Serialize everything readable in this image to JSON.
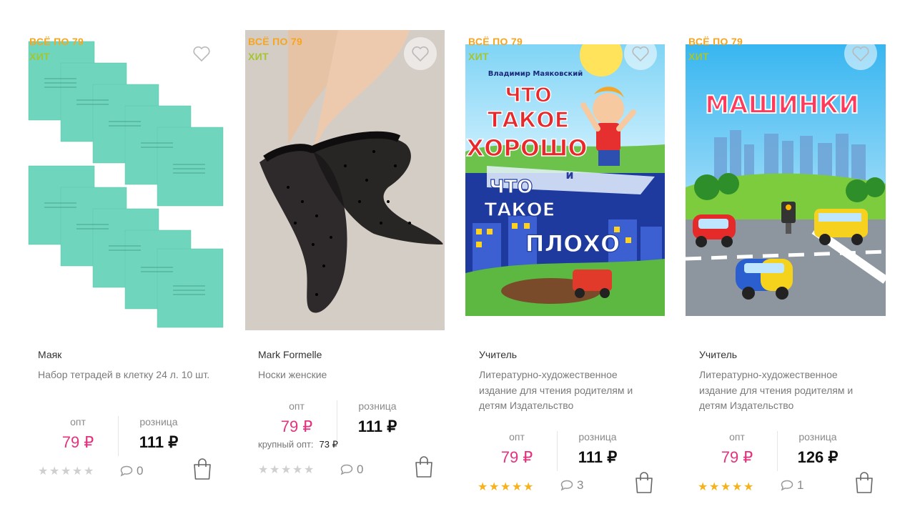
{
  "products": [
    {
      "badges": {
        "sale": "ВСЁ ПО 79",
        "hit": "ХИТ"
      },
      "image_icon": "notebooks-image",
      "brand": "Маяк",
      "description": "Набор тетрадей в клетку 24 л. 10 шт.",
      "labels": {
        "opt": "опт",
        "retail": "розница"
      },
      "price_opt": "79 ₽",
      "price_retail": "111 ₽",
      "rating": 0,
      "comments": "0"
    },
    {
      "badges": {
        "sale": "ВСЁ ПО 79",
        "hit": "ХИТ"
      },
      "image_icon": "socks-image",
      "brand": "Mark Formelle",
      "description": "Носки женские",
      "labels": {
        "opt": "опт",
        "retail": "розница"
      },
      "price_opt": "79 ₽",
      "price_retail": "111 ₽",
      "bulk_label": "крупный опт:",
      "bulk_price": "73 ₽",
      "rating": 0,
      "comments": "0"
    },
    {
      "badges": {
        "sale": "ВСЁ ПО 79",
        "hit": "ХИТ"
      },
      "image_icon": "book-cover-image",
      "image_text": {
        "author": "Владимир Маяковский",
        "line1": "ЧТО",
        "line2": "ТАКОЕ",
        "line3": "ХОРОШО",
        "and": "и",
        "line4": "ЧТО",
        "line5": "ТАКОЕ",
        "line6": "ПЛОХО"
      },
      "brand": "Учитель",
      "description": "Литературно-художественное издание для чтения родителям и детям Издательство",
      "labels": {
        "opt": "опт",
        "retail": "розница"
      },
      "price_opt": "79 ₽",
      "price_retail": "111 ₽",
      "rating": 5,
      "comments": "3"
    },
    {
      "badges": {
        "sale": "ВСЁ ПО 79",
        "hit": "ХИТ"
      },
      "image_icon": "book-cover-image",
      "image_text": {
        "title": "МАШИНКИ"
      },
      "brand": "Учитель",
      "description": "Литературно-художественное издание для чтения родителям и детям Издательство",
      "labels": {
        "opt": "опт",
        "retail": "розница"
      },
      "price_opt": "79 ₽",
      "price_retail": "126 ₽",
      "rating": 5,
      "comments": "1"
    }
  ],
  "colors": {
    "sale": "#f7a51f",
    "hit": "#a4c534",
    "price_opt": "#e2337f",
    "star_on": "#f6b21c",
    "star_off": "#cfcfcf"
  },
  "icons": {
    "favorite": "heart-icon",
    "comments": "comment-bubble-icon",
    "cart": "shopping-bag-icon"
  }
}
